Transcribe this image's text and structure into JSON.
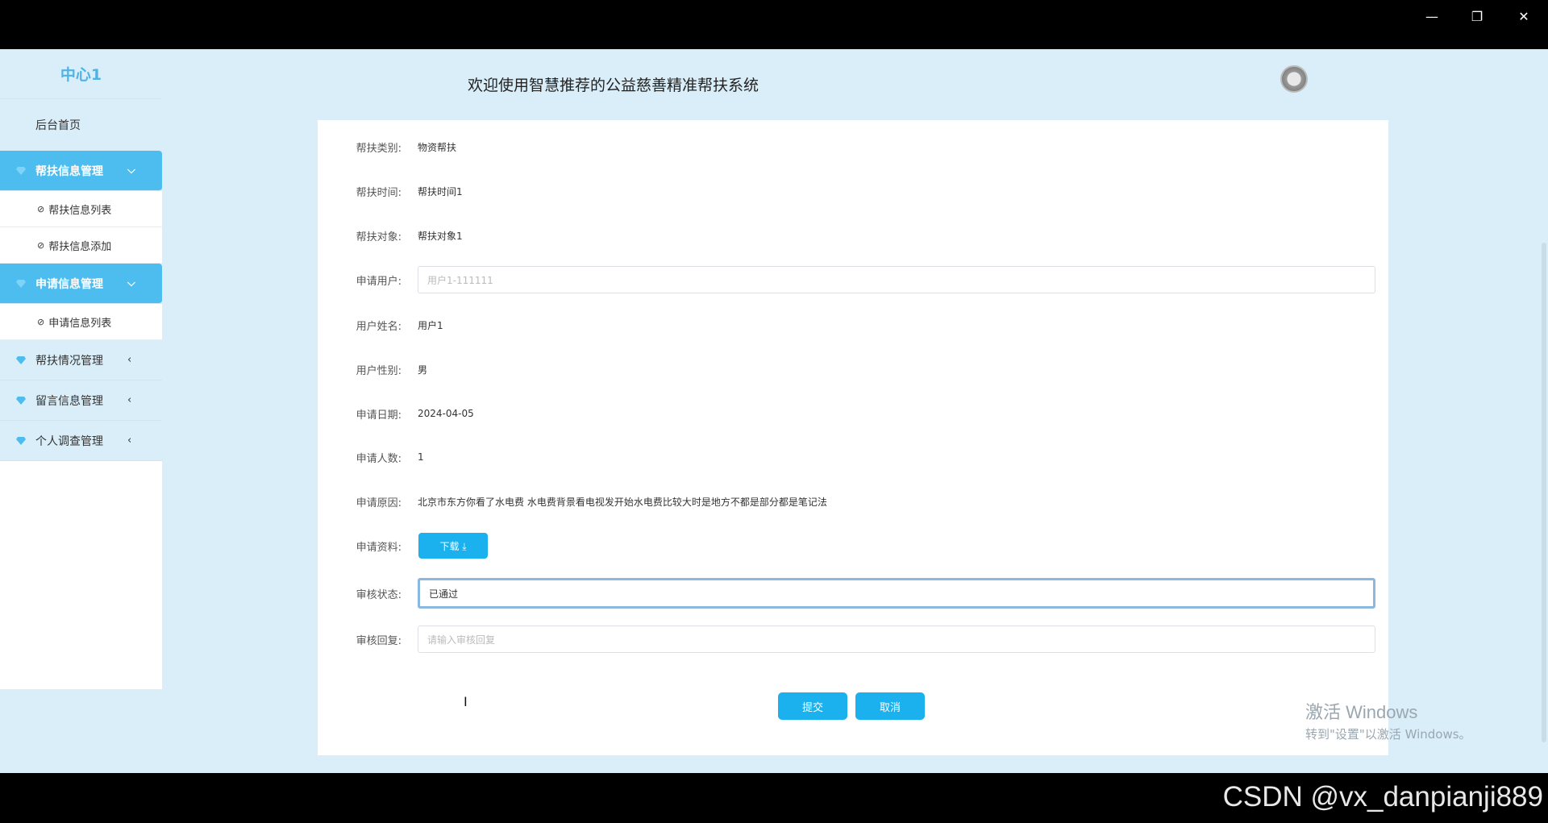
{
  "window": {
    "min_icon": "—",
    "max_icon": "❐",
    "close_icon": "✕"
  },
  "sidebar": {
    "brand": "中心1",
    "home": "后台首页",
    "groups": [
      {
        "label": "帮扶信息管理",
        "arrow": "⌵",
        "items": [
          "帮扶信息列表",
          "帮扶信息添加"
        ]
      },
      {
        "label": "申请信息管理",
        "arrow": "⌵",
        "items": [
          "申请信息列表"
        ]
      },
      {
        "label": "帮扶情况管理",
        "arrow": "‹"
      },
      {
        "label": "留言信息管理",
        "arrow": "‹"
      },
      {
        "label": "个人调查管理",
        "arrow": "‹"
      }
    ]
  },
  "header": {
    "title": "欢迎使用智慧推荐的公益慈善精准帮扶系统"
  },
  "form": {
    "category": {
      "label": "帮扶类别:",
      "value": "物资帮扶"
    },
    "time": {
      "label": "帮扶时间:",
      "value": "帮扶时间1"
    },
    "target": {
      "label": "帮扶对象:",
      "value": "帮扶对象1"
    },
    "user": {
      "label": "申请用户:",
      "placeholder": "用户1-111111"
    },
    "name": {
      "label": "用户姓名:",
      "value": "用户1"
    },
    "gender": {
      "label": "用户性别:",
      "value": "男"
    },
    "date": {
      "label": "申请日期:",
      "value": "2024-04-05"
    },
    "count": {
      "label": "申请人数:",
      "value": "1"
    },
    "reason": {
      "label": "申请原因:",
      "value": "北京市东方你看了水电费 水电费背景看电视发开始水电费比较大时是地方不都是部分都是笔记法"
    },
    "material": {
      "label": "申请资料:",
      "button": "下载 ⤓"
    },
    "status": {
      "label": "审核状态:",
      "value": "已通过"
    },
    "reply": {
      "label": "审核回复:",
      "placeholder": "请输入审核回复"
    }
  },
  "actions": {
    "submit": "提交",
    "cancel": "取消"
  },
  "os": {
    "activate_title": "激活 Windows",
    "activate_sub": "转到\"设置\"以激活 Windows。"
  },
  "watermark": "CSDN @vx_danpianji889"
}
